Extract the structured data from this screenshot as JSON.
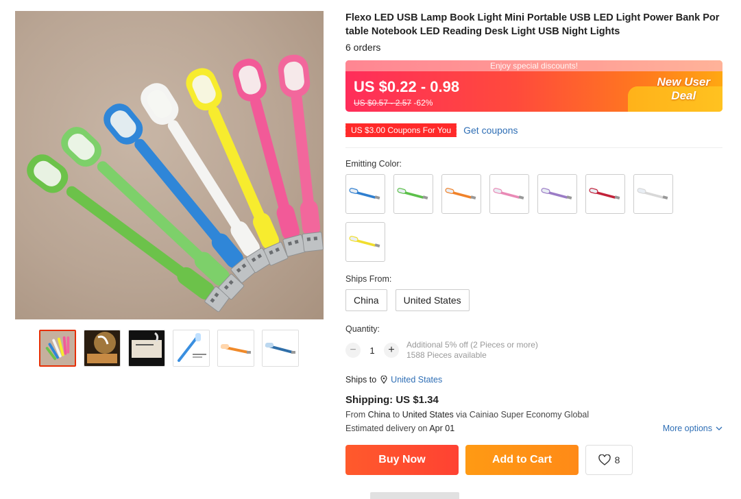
{
  "product": {
    "title": "Flexo LED USB Lamp Book Light Mini Portable USB LED Light Power Bank Portable Notebook LED Reading Desk Light USB Night Lights",
    "orders": "6 orders"
  },
  "price": {
    "banner_text": "Enjoy special discounts!",
    "current": "US $0.22 - 0.98",
    "original": "US $0.57 - 2.57",
    "discount": "-62%",
    "badge_line1": "New User",
    "badge_line2": "Deal"
  },
  "coupon": {
    "tag": "US $3.00 Coupons For You",
    "link": "Get coupons"
  },
  "emitting_color": {
    "label": "Emitting Color:",
    "options": [
      {
        "color": "#2f7fd0",
        "name": "blue"
      },
      {
        "color": "#5cc04a",
        "name": "green"
      },
      {
        "color": "#f0822a",
        "name": "orange"
      },
      {
        "color": "#e98ab6",
        "name": "pink"
      },
      {
        "color": "#9b7cc6",
        "name": "purple"
      },
      {
        "color": "#c2223a",
        "name": "red"
      },
      {
        "color": "#d8d8d8",
        "name": "white"
      },
      {
        "color": "#f1de2e",
        "name": "yellow"
      }
    ]
  },
  "ships_from": {
    "label": "Ships From:",
    "options": [
      "China",
      "United States"
    ]
  },
  "quantity": {
    "label": "Quantity:",
    "value": "1",
    "minus": "−",
    "plus": "+",
    "promo": "Additional 5% off (2 Pieces or more)",
    "available": "1588 Pieces available"
  },
  "ships_to": {
    "label": "Ships to",
    "country": "United States"
  },
  "shipping": {
    "title": "Shipping: US $1.34",
    "from_prefix": "From",
    "from": "China",
    "to_prefix": "to",
    "to": "United States",
    "via": "via Cainiao Super Economy Global",
    "eta_prefix": "Estimated delivery on",
    "eta": "Apr 01",
    "more_options": "More options"
  },
  "actions": {
    "buy_now": "Buy Now",
    "add_to_cart": "Add to Cart",
    "wishlist_count": "8"
  },
  "gallery": {
    "lamp_colors": [
      "#6cc24a",
      "#7dd06a",
      "#2f86d8",
      "#f4f4f2",
      "#f7ec2e",
      "#f25a98",
      "#f2679c"
    ],
    "thumbs": [
      "thumb-lamps-fan",
      "thumb-lamp-glow",
      "thumb-lamp-laptop",
      "thumb-blue-lamp-card",
      "thumb-orange-lamp",
      "thumb-blue-lamp"
    ]
  }
}
